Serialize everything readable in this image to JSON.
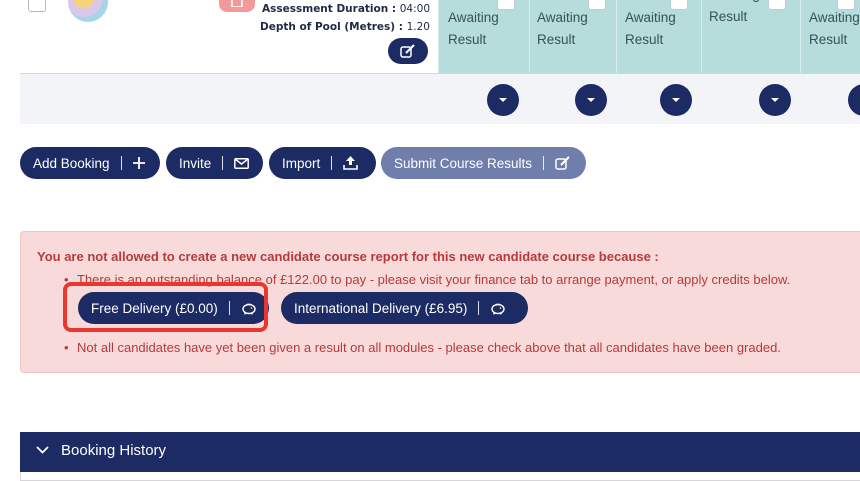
{
  "candidate_row": {
    "assessment_duration_label": "Assessment Duration :",
    "assessment_duration_value": "04:00",
    "pool_depth_label": "Depth of Pool (Metres) :",
    "pool_depth_value": "1.20",
    "results": [
      "Awaiting Result",
      "Awaiting Result",
      "Awaiting Result",
      "Awaiting Result",
      "Awaiting Result"
    ]
  },
  "actions": {
    "add_booking": "Add Booking",
    "invite": "Invite",
    "import": "Import",
    "submit_course_results": "Submit Course Results"
  },
  "alert": {
    "title": "You are not allowed to create a new candidate course report for this new candidate course because :",
    "balance_message": "There is an outstanding balance of £122.00 to pay - please visit your finance tab to arrange payment, or apply credits below.",
    "free_delivery": "Free Delivery (£0.00)",
    "international_delivery": "International Delivery (£6.95)",
    "results_message": "Not all candidates have yet been given a result on all modules - please check above that all candidates have been graded."
  },
  "booking_history": {
    "title": "Booking History"
  },
  "colors": {
    "navy": "#1c2b64",
    "result_cell": "#b7dcdc",
    "alert_bg": "#f9dada",
    "alert_text": "#b53a3a",
    "highlight": "#e8372e"
  }
}
